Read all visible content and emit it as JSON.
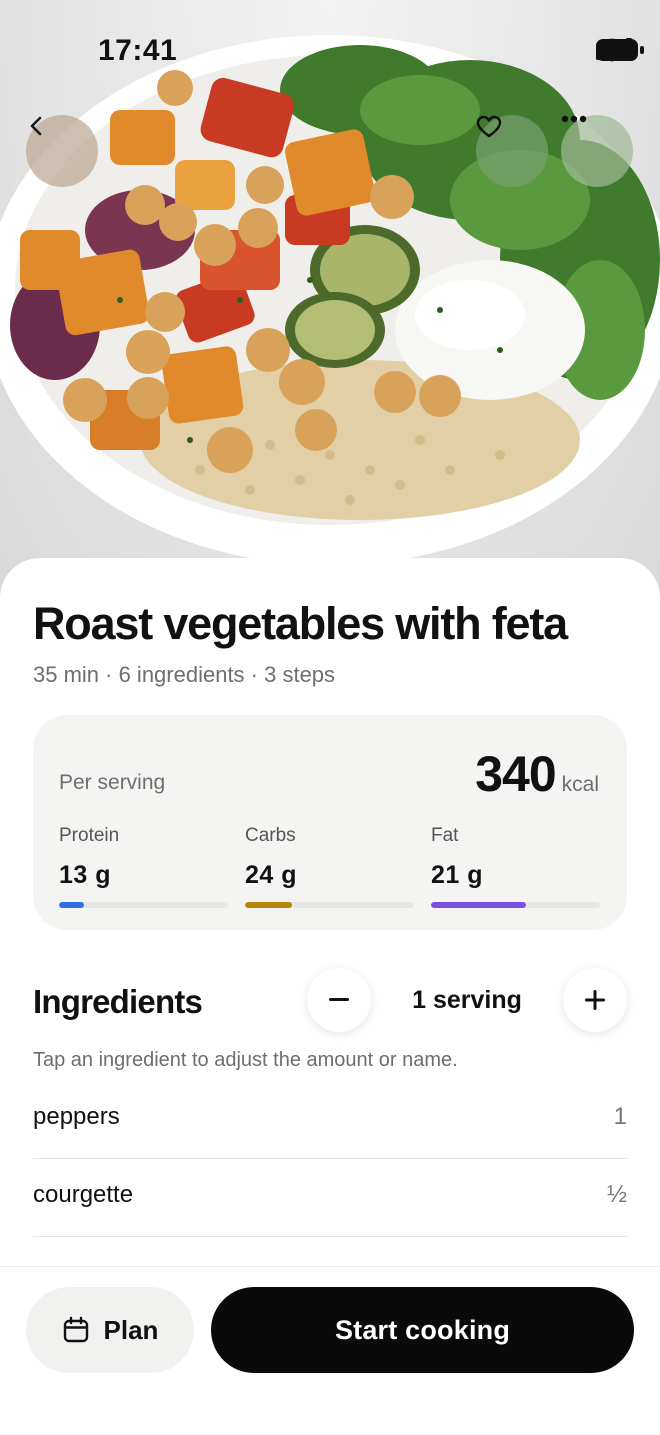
{
  "status_bar": {
    "time": "17:41"
  },
  "recipe": {
    "title": "Roast vegetables with feta",
    "meta": "35 min · 6 ingredients · 3 steps"
  },
  "nutrition": {
    "per_serving_label": "Per serving",
    "kcal_value": "340",
    "kcal_unit": "kcal",
    "macros": [
      {
        "label": "Protein",
        "value": "13 g",
        "fill_fraction": 0.15,
        "color": "#2f6fe4"
      },
      {
        "label": "Carbs",
        "value": "24 g",
        "fill_fraction": 0.28,
        "color": "#b8860b"
      },
      {
        "label": "Fat",
        "value": "21 g",
        "fill_fraction": 0.56,
        "color": "#7b4fe0"
      }
    ]
  },
  "ingredients": {
    "heading": "Ingredients",
    "serving_label": "1 serving",
    "hint": "Tap an ingredient to adjust the amount or name.",
    "items": [
      {
        "name": "peppers",
        "qty": "1"
      },
      {
        "name": "courgette",
        "qty": "½"
      }
    ]
  },
  "actions": {
    "plan_label": "Plan",
    "start_label": "Start cooking"
  },
  "icons": {
    "back": "chevron-left-icon",
    "favorite": "heart-icon",
    "more": "ellipsis-icon",
    "minus": "minus-icon",
    "plus": "plus-icon",
    "calendar": "calendar-icon"
  }
}
